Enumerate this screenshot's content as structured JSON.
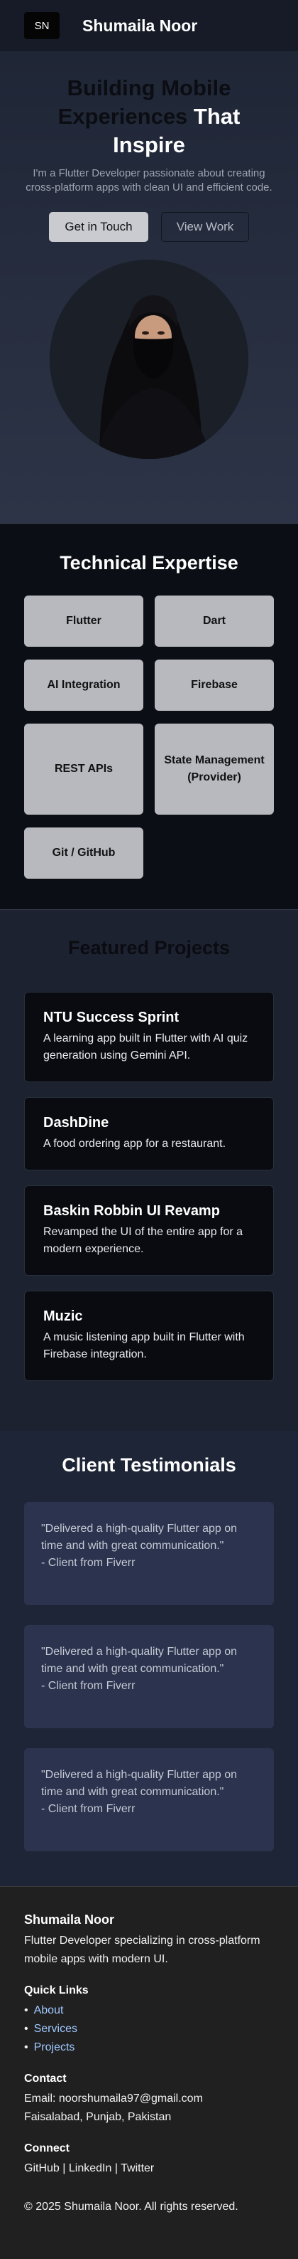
{
  "header": {
    "logo": "SN",
    "brand": "Shumaila Noor"
  },
  "hero": {
    "title_a": "Building Mobile Experiences",
    "title_b": "That Inspire",
    "subtitle": "I'm a Flutter Developer passionate about creating cross-platform apps with clean UI and efficient code.",
    "primary_button": "Get in Touch",
    "secondary_button": "View Work"
  },
  "expertise": {
    "title": "Technical Expertise",
    "skills": [
      "Flutter",
      "Dart",
      "AI Integration",
      "Firebase",
      "REST APIs",
      "State Management (Provider)",
      "Git / GitHub"
    ]
  },
  "projects": {
    "title": "Featured Projects",
    "items": [
      {
        "name": "NTU Success Sprint",
        "desc": "A learning app built in Flutter with AI quiz generation using Gemini API."
      },
      {
        "name": "DashDine",
        "desc": "A food ordering app for a restaurant."
      },
      {
        "name": "Baskin Robbin UI Revamp",
        "desc": "Revamped the UI of the entire app for a modern experience."
      },
      {
        "name": "Muzic",
        "desc": "A music listening app built in Flutter with Firebase integration."
      }
    ]
  },
  "testimonials": {
    "title": "Client Testimonials",
    "items": [
      {
        "quote": "\"Delivered a high-quality Flutter app on time and with great communication.\"",
        "author": "- Client from Fiverr"
      },
      {
        "quote": "\"Delivered a high-quality Flutter app on time and with great communication.\"",
        "author": "- Client from Fiverr"
      },
      {
        "quote": "\"Delivered a high-quality Flutter app on time and with great communication.\"",
        "author": "- Client from Fiverr"
      }
    ]
  },
  "footer": {
    "name": "Shumaila Noor",
    "tagline": "Flutter Developer specializing in cross-platform mobile apps with modern UI.",
    "quick_links_title": "Quick Links",
    "quick_links": [
      "About",
      "Services",
      "Projects"
    ],
    "contact_title": "Contact",
    "email": "Email: noorshumaila97@gmail.com",
    "location": "Faisalabad, Punjab, Pakistan",
    "connect_title": "Connect",
    "social": [
      "GitHub",
      "LinkedIn",
      "Twitter"
    ],
    "copyright": "© 2025 Shumaila Noor. All rights reserved."
  }
}
